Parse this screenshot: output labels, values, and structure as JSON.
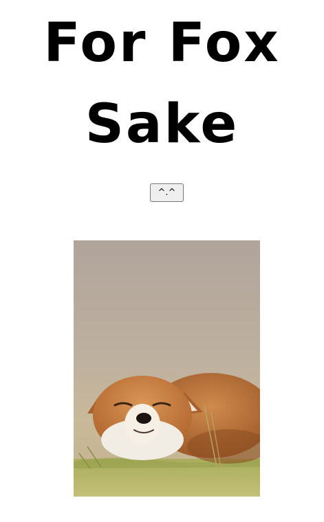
{
  "page": {
    "title": "For Fox Sake",
    "button_label": "^.^"
  },
  "image": {
    "subject_icon": "sleeping-fox-photo",
    "colors": {
      "background_top": "#b3a69c",
      "background_mid": "#c5b59e",
      "grass": "#b7bd6f",
      "fox_orange": "#c97a3a",
      "fox_white": "#f1ece4"
    }
  }
}
